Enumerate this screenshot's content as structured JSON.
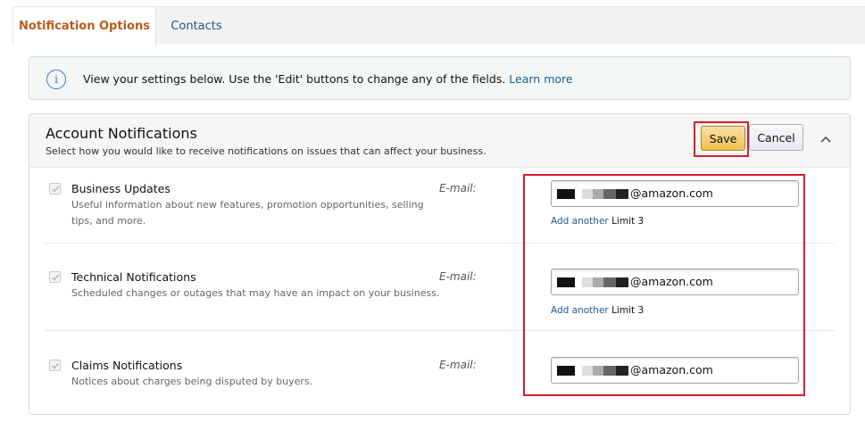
{
  "tabs": [
    {
      "label": "Notification Options"
    },
    {
      "label": "Contacts"
    }
  ],
  "info": {
    "text": "View your settings below. Use the 'Edit' buttons to change any of the fields.",
    "link": "Learn more",
    "icon": "info-icon"
  },
  "panel": {
    "title": "Account Notifications",
    "subtitle": "Select how you would like to receive notifications on issues that can affect your business.",
    "save_label": "Save",
    "cancel_label": "Cancel"
  },
  "rows": [
    {
      "title": "Business Updates",
      "desc": "Useful information about new features, promotion opportunities, selling tips, and more.",
      "email_label": "E-mail:",
      "email_domain": "@amazon.com",
      "add_another": "Add another",
      "limit": "Limit 3",
      "checked": true
    },
    {
      "title": "Technical Notifications",
      "desc": "Scheduled changes or outages that may have an impact on your business.",
      "email_label": "E-mail:",
      "email_domain": "@amazon.com",
      "add_another": "Add another",
      "limit": "Limit 3",
      "checked": true
    },
    {
      "title": "Claims Notifications",
      "desc": "Notices about charges being disputed by buyers.",
      "email_label": "E-mail:",
      "email_domain": "@amazon.com",
      "checked": true
    }
  ],
  "colors": {
    "active_tab": "#b85c1a",
    "link": "#1f5b90",
    "highlight_outline": "#d0212d",
    "save_button": "#f0c14b"
  }
}
